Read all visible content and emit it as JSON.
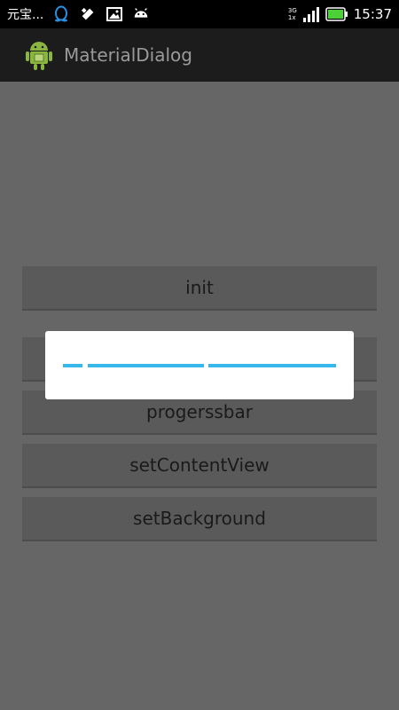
{
  "status_bar": {
    "carrier": "元宝...",
    "network_top": "3G",
    "network_bottom": "1x",
    "time": "15:37"
  },
  "action_bar": {
    "title": "MaterialDialog"
  },
  "buttons": [
    {
      "label": "init"
    },
    {
      "label": ""
    },
    {
      "label": "progerssbar"
    },
    {
      "label": "setContentView"
    },
    {
      "label": "setBackground"
    }
  ],
  "colors": {
    "accent": "#36b9ea",
    "dim_background": "#666666",
    "action_bar": "#1c1c1c"
  },
  "icons": [
    "qq-penguin-icon",
    "usb-debug-icon",
    "image-icon",
    "android-icon",
    "signal-icon",
    "battery-icon",
    "app-launcher-icon"
  ]
}
